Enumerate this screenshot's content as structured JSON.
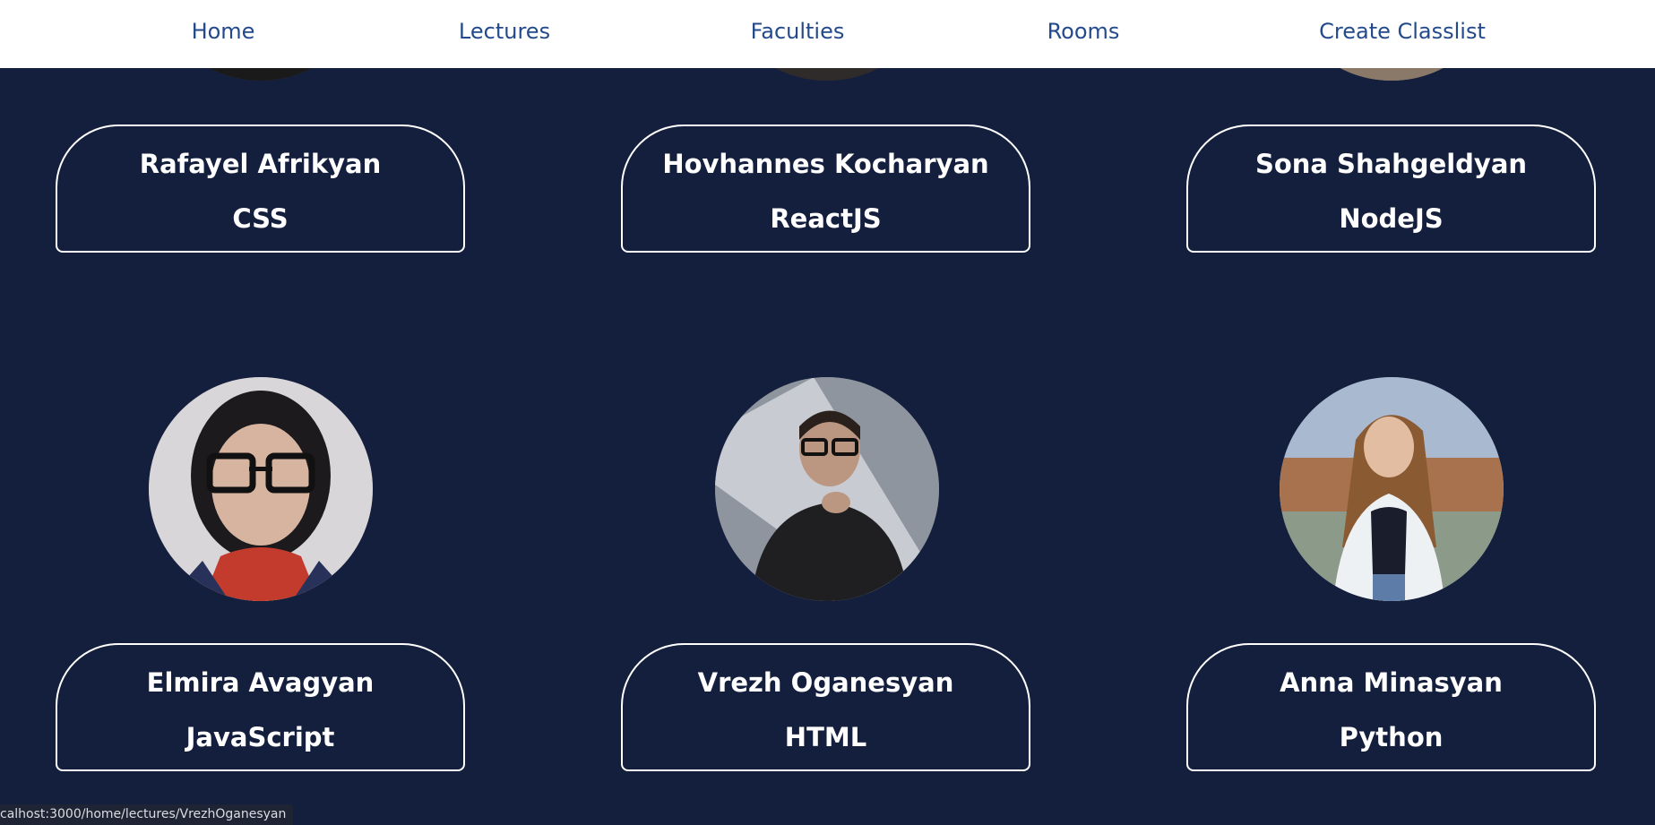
{
  "nav": {
    "links": [
      {
        "label": "Home"
      },
      {
        "label": "Lectures"
      },
      {
        "label": "Faculties"
      },
      {
        "label": "Rooms"
      },
      {
        "label": "Create Classlist"
      }
    ]
  },
  "lecturers": [
    {
      "name": "Rafayel Afrikyan",
      "subject": "CSS"
    },
    {
      "name": "Hovhannes Kocharyan",
      "subject": "ReactJS"
    },
    {
      "name": "Sona Shahgeldyan",
      "subject": "NodeJS"
    },
    {
      "name": "Elmira Avagyan",
      "subject": "JavaScript"
    },
    {
      "name": "Vrezh Oganesyan",
      "subject": "HTML"
    },
    {
      "name": "Anna Minasyan",
      "subject": "Python"
    }
  ],
  "status_bar": {
    "url": "calhost:3000/home/lectures/VrezhOganesyan"
  }
}
